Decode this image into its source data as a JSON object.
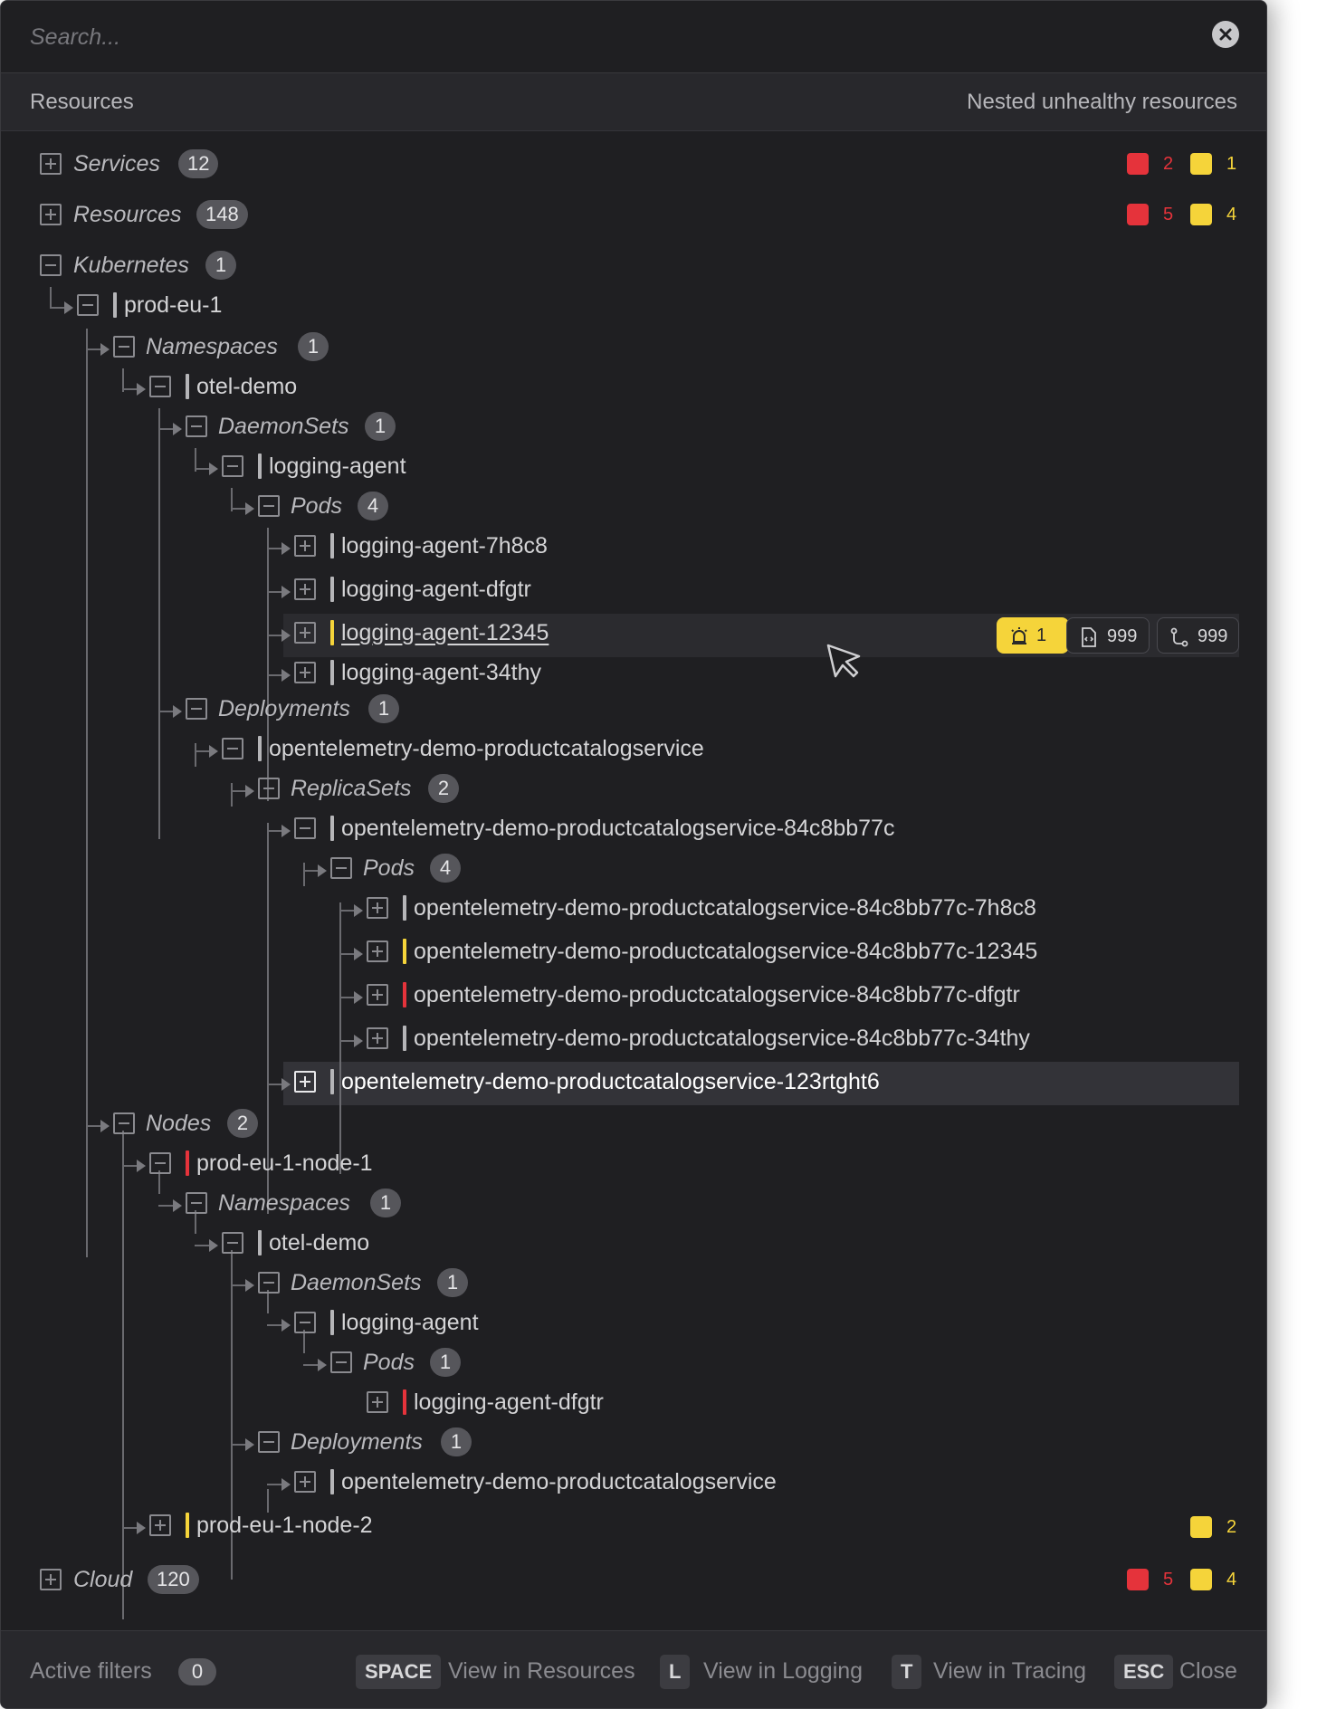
{
  "search": {
    "placeholder": "Search..."
  },
  "columns": {
    "left": "Resources",
    "right": "Nested unhealthy resources"
  },
  "tree": {
    "services": {
      "label": "Services",
      "count": "12",
      "red": "2",
      "yellow": "1"
    },
    "resources": {
      "label": "Resources",
      "count": "148",
      "red": "5",
      "yellow": "4"
    },
    "kubernetes": {
      "label": "Kubernetes",
      "count": "1"
    },
    "cluster": {
      "label": "prod-eu-1"
    },
    "namespaces": {
      "label": "Namespaces",
      "count": "1"
    },
    "otel_demo": {
      "label": "otel-demo"
    },
    "daemonsets": {
      "label": "DaemonSets",
      "count": "1"
    },
    "logging_agent": {
      "label": "logging-agent"
    },
    "pods": {
      "label": "Pods",
      "count": "4"
    },
    "pod_items": [
      {
        "label": "logging-agent-7h8c8"
      },
      {
        "label": "logging-agent-dfgtr"
      },
      {
        "label": "logging-agent-12345"
      },
      {
        "label": "logging-agent-34thy"
      }
    ],
    "actions": {
      "alerts": "1",
      "logs": "999",
      "traces": "999"
    },
    "deployments": {
      "label": "Deployments",
      "count": "1"
    },
    "deployment_item": {
      "label": "opentelemetry-demo-productcatalogservice"
    },
    "replicasets": {
      "label": "ReplicaSets",
      "count": "2"
    },
    "replicaset_1": {
      "label": "opentelemetry-demo-productcatalogservice-84c8bb77c"
    },
    "rs_pods": {
      "label": "Pods",
      "count": "4"
    },
    "rs_pod_items": [
      {
        "label": "opentelemetry-demo-productcatalogservice-84c8bb77c-7h8c8"
      },
      {
        "label": "opentelemetry-demo-productcatalogservice-84c8bb77c-12345"
      },
      {
        "label": "opentelemetry-demo-productcatalogservice-84c8bb77c-dfgtr"
      },
      {
        "label": "opentelemetry-demo-productcatalogservice-84c8bb77c-34thy"
      }
    ],
    "replicaset_2": {
      "label": "opentelemetry-demo-productcatalogservice-123rtght6"
    },
    "nodes": {
      "label": "Nodes",
      "count": "2"
    },
    "node_1": {
      "label": "prod-eu-1-node-1"
    },
    "n_namespaces": {
      "label": "Namespaces",
      "count": "1"
    },
    "n_otel_demo": {
      "label": "otel-demo"
    },
    "n_daemonsets": {
      "label": "DaemonSets",
      "count": "1"
    },
    "n_logging_agent": {
      "label": "logging-agent"
    },
    "n_pods": {
      "label": "Pods",
      "count": "1"
    },
    "n_pod_item": {
      "label": "logging-agent-dfgtr"
    },
    "n_deployments": {
      "label": "Deployments",
      "count": "1"
    },
    "n_deployment_item": {
      "label": "opentelemetry-demo-productcatalogservice"
    },
    "node_2": {
      "label": "prod-eu-1-node-2",
      "yellow": "2"
    },
    "cloud": {
      "label": "Cloud",
      "count": "120",
      "red": "5",
      "yellow": "4"
    }
  },
  "footer": {
    "active_filters": "Active filters",
    "filters_count": "0",
    "shortcuts": [
      {
        "key": "SPACE",
        "label": "View in Resources"
      },
      {
        "key": "L",
        "label": "View in Logging"
      },
      {
        "key": "T",
        "label": "View in Tracing"
      },
      {
        "key": "ESC",
        "label": "Close"
      }
    ]
  },
  "colors": {
    "red": "#e5333b",
    "yellow": "#f5d43a",
    "background": "#1f1f22"
  }
}
